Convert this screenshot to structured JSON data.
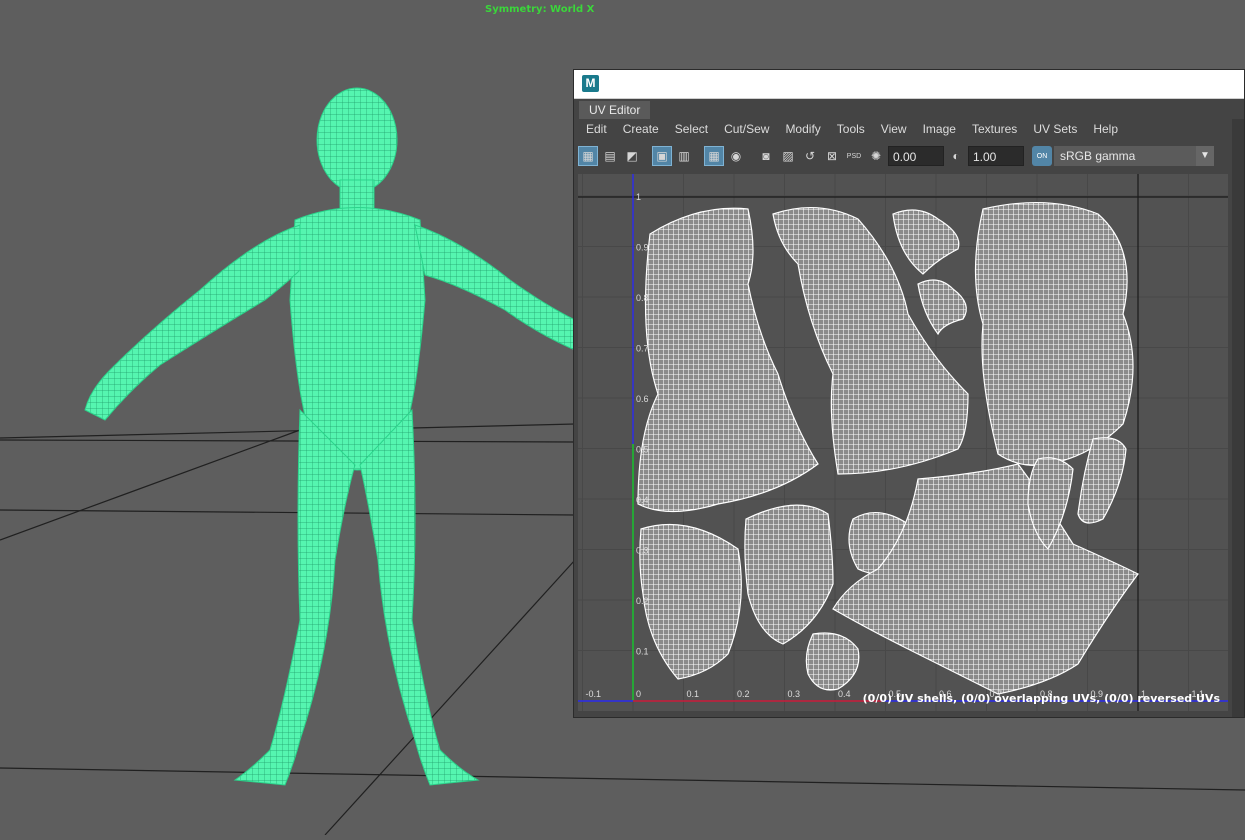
{
  "viewport": {
    "symmetry_label": "Symmetry: World X"
  },
  "uv_editor": {
    "logo": "M",
    "tab_label": "UV Editor",
    "menus": [
      "Edit",
      "Create",
      "Select",
      "Cut/Sew",
      "Modify",
      "Tools",
      "View",
      "Image",
      "Textures",
      "UV Sets",
      "Help"
    ],
    "exposure_value": "0.00",
    "gamma_value": "1.00",
    "color_space": "sRGB gamma",
    "on_badge": "ON",
    "u_ticks": [
      "-0.1",
      "0",
      "0.1",
      "0.2",
      "0.3",
      "0.4",
      "0.5",
      "0.6",
      "0.7",
      "0.8",
      "0.9",
      "1",
      "1.1"
    ],
    "v_ticks": [
      "1",
      "0.9",
      "0.8",
      "0.7",
      "0.6",
      "0.5",
      "0.4",
      "0.3",
      "0.2",
      "0.1"
    ],
    "status_text": "(0/0) UV shells, (0/0) overlapping UVs, (0/0) reversed UVs"
  },
  "colors": {
    "mesh": "#3ff0a0",
    "viewport_bg": "#5e5e5e",
    "uv_shell": "#ffffff",
    "u_axis": "#d02020",
    "v_axis": "#20c020",
    "accent": "#5285a6"
  },
  "icons": [
    "uv-shell-icon",
    "uv-grid-icon",
    "uv-layout-icon",
    "texture-border-icon",
    "checker-icon",
    "grid-toggle-icon",
    "isolate-icon",
    "snapshot-icon",
    "image-icon",
    "unfold-icon",
    "dim-image-icon",
    "psd-icon",
    "exposure-icon",
    "gamma-icon"
  ]
}
